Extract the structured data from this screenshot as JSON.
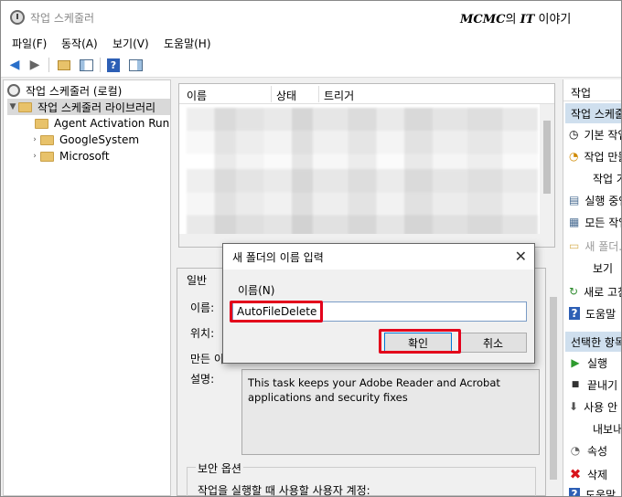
{
  "window": {
    "title": "작업 스케줄러"
  },
  "watermark": {
    "brand": "MCMC",
    "particle": "의",
    "bold": "IT",
    "suffix": "이야기"
  },
  "menu": [
    "파일(F)",
    "동작(A)",
    "보기(V)",
    "도움말(H)"
  ],
  "toolbar": {
    "icons": [
      "back-arrow-icon",
      "forward-arrow-icon",
      "folder-up-icon",
      "show-hide-pane-icon",
      "help-icon",
      "properties-pane-icon"
    ]
  },
  "tree": {
    "root": "작업 스케줄러 (로컬)",
    "library": "작업 스케줄러 라이브러리",
    "children": [
      "Agent Activation Run",
      "GoogleSystem",
      "Microsoft"
    ]
  },
  "list": {
    "columns": [
      "이름",
      "상태",
      "트리거"
    ]
  },
  "details": {
    "tab": "일반",
    "name_label": "이름:",
    "location_label": "위치:",
    "author_label": "만든 이",
    "description_label": "설명:",
    "description": "This task keeps your Adobe Reader and Acrobat applications and security fixes",
    "security_title": "보안 옵션",
    "security_text": "작업을 실행할 때 사용할 사용자 계정:"
  },
  "actions": {
    "header": "작업",
    "section1": "작업 스케줄러 라이브러리",
    "items1": [
      {
        "icon": "basic-task-icon",
        "glyph": "◷",
        "label": "기본 작업 만들기..."
      },
      {
        "icon": "create-task-icon",
        "glyph": "◔",
        "label": "작업 만들기..."
      },
      {
        "icon": "",
        "glyph": "",
        "label": "작업 가져오기..."
      },
      {
        "icon": "running-tasks-icon",
        "glyph": "▤",
        "label": "실행 중인 모든 작업 표시"
      },
      {
        "icon": "history-icon",
        "glyph": "▦",
        "label": "모든 작업 기록 사용"
      },
      {
        "icon": "new-folder-icon",
        "glyph": "▭",
        "label": "새 폴더..."
      },
      {
        "icon": "",
        "glyph": "",
        "label": "보기"
      },
      {
        "icon": "refresh-icon",
        "glyph": "↻",
        "label": "새로 고침"
      },
      {
        "icon": "help-icon",
        "glyph": "?",
        "label": "도움말"
      }
    ],
    "section2": "선택한 항목",
    "items2": [
      {
        "icon": "run-icon",
        "glyph": "▶",
        "label": "실행"
      },
      {
        "icon": "end-icon",
        "glyph": "■",
        "label": "끝내기"
      },
      {
        "icon": "disable-icon",
        "glyph": "⬇",
        "label": "사용 안 함"
      },
      {
        "icon": "",
        "glyph": "",
        "label": "내보내기..."
      },
      {
        "icon": "properties-icon",
        "glyph": "◔",
        "label": "속성"
      },
      {
        "icon": "delete-icon",
        "glyph": "✖",
        "label": "삭제"
      },
      {
        "icon": "help-icon",
        "glyph": "?",
        "label": "도움말"
      }
    ]
  },
  "dialog": {
    "title": "새 폴더의 이름 입력",
    "label": "이름(N)",
    "value": "AutoFileDelete",
    "ok": "확인",
    "cancel": "취소"
  },
  "colors": {
    "highlight": "#e3001b",
    "action_section": "#cfdfee",
    "folder": "#e8c26a"
  }
}
